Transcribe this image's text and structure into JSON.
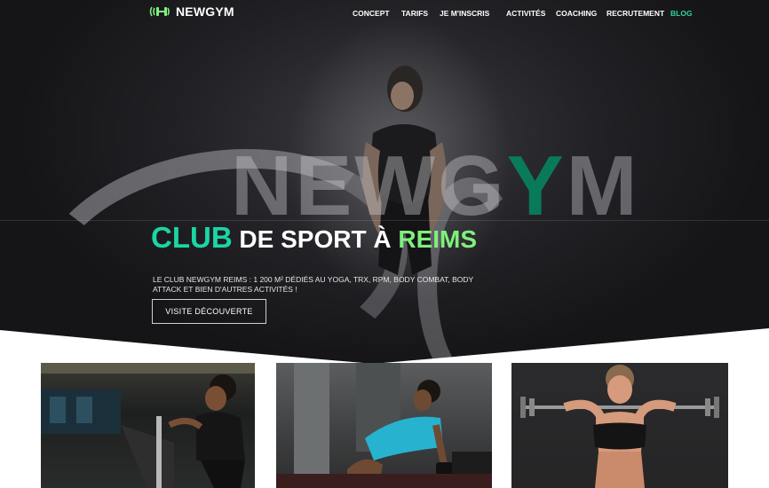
{
  "brand": {
    "name": "NEWGYM"
  },
  "nav": {
    "items": [
      {
        "label": "CONCEPT"
      },
      {
        "label": "TARIFS"
      },
      {
        "label": "JE M'INSCRIS"
      },
      {
        "label": "ACTIVITÉS"
      },
      {
        "label": "COACHING"
      },
      {
        "label": "RECRUTEMENT"
      },
      {
        "label": "BLOG",
        "active": true
      }
    ]
  },
  "hero": {
    "bigword_main": "NEWG",
    "bigword_accent": "Y",
    "bigword_end": "M",
    "headline_club": "CLUB",
    "headline_middle": " DE SPORT À ",
    "headline_city": "REIMS",
    "description": "Le club NewGym Reims : 1 200 m² dédiés au yoga, TRX, RPM, Body combat, Body attack et bien d'autres activités !",
    "cta_label": "VISITE DÉCOUVERTE"
  },
  "colors": {
    "accent_teal": "#1ad6a4",
    "accent_green": "#7ff07a",
    "nav_active": "#2fd3a3"
  },
  "cards": [
    {
      "subject": "woman-on-exercise-bike"
    },
    {
      "subject": "woman-lifting-dumbbell"
    },
    {
      "subject": "woman-with-barbell"
    }
  ]
}
